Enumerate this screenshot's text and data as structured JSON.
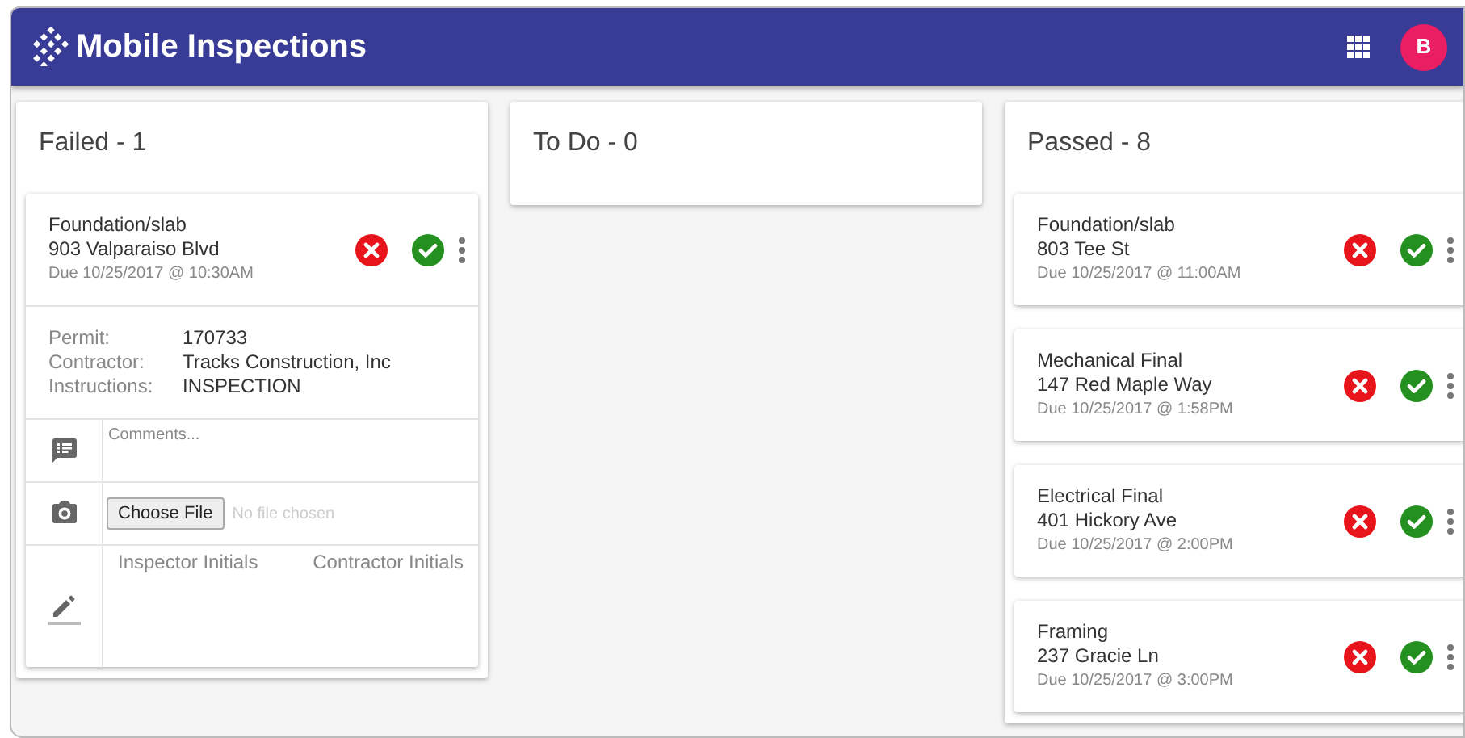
{
  "app": {
    "title": "Mobile Inspections",
    "avatar": "B"
  },
  "columns": [
    {
      "title": "Failed - 1",
      "cards": [
        {
          "type": "Foundation/slab",
          "address": "903 Valparaiso Blvd",
          "due": "Due 10/25/2017 @ 10:30AM",
          "expanded": true,
          "details": [
            {
              "label": "Permit:",
              "value": "170733"
            },
            {
              "label": "Contractor:",
              "value": "Tracks Construction, Inc"
            },
            {
              "label": "Instructions:",
              "value": "INSPECTION"
            }
          ],
          "comments_placeholder": "Comments...",
          "file_button": "Choose File",
          "file_status": "No file chosen",
          "signatures": [
            "Inspector Initials",
            "Contractor Initials"
          ]
        }
      ]
    },
    {
      "title": "To Do - 0"
    },
    {
      "title": "Passed - 8",
      "cards": [
        {
          "type": "Foundation/slab",
          "address": "803 Tee St",
          "due": "Due 10/25/2017 @ 11:00AM",
          "expanded": false
        },
        {
          "type": "Mechanical Final",
          "address": "147 Red Maple Way",
          "due": "Due 10/25/2017 @ 1:58PM",
          "expanded": false
        },
        {
          "type": "Electrical Final",
          "address": "401 Hickory Ave",
          "due": "Due 10/25/2017 @ 2:00PM",
          "expanded": false
        },
        {
          "type": "Framing",
          "address": "237 Gracie Ln",
          "due": "Due 10/25/2017 @ 3:00PM",
          "expanded": false
        }
      ]
    }
  ]
}
